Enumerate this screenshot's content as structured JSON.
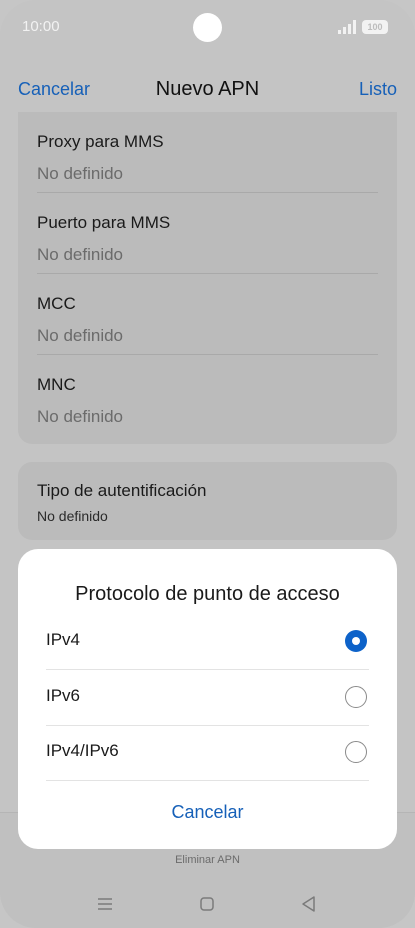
{
  "status_bar": {
    "time": "10:00",
    "battery": "100"
  },
  "header": {
    "cancel_label": "Cancelar",
    "title": "Nuevo APN",
    "done_label": "Listo"
  },
  "fields": [
    {
      "label": "Proxy para MMS",
      "value": "No definido"
    },
    {
      "label": "Puerto para MMS",
      "value": "No definido"
    },
    {
      "label": "MCC",
      "value": "No definido"
    },
    {
      "label": "MNC",
      "value": "No definido"
    }
  ],
  "auth": {
    "label": "Tipo de autentificación",
    "value": "No definido"
  },
  "dialog": {
    "title": "Protocolo de punto de acceso",
    "options": [
      {
        "label": "IPv4",
        "selected": true
      },
      {
        "label": "IPv6",
        "selected": false
      },
      {
        "label": "IPv4/IPv6",
        "selected": false
      }
    ],
    "cancel_label": "Cancelar"
  },
  "bottom": {
    "delete_label": "Eliminar APN"
  },
  "colors": {
    "accent": "#1660b8",
    "radio_selected": "#0d62c9"
  }
}
